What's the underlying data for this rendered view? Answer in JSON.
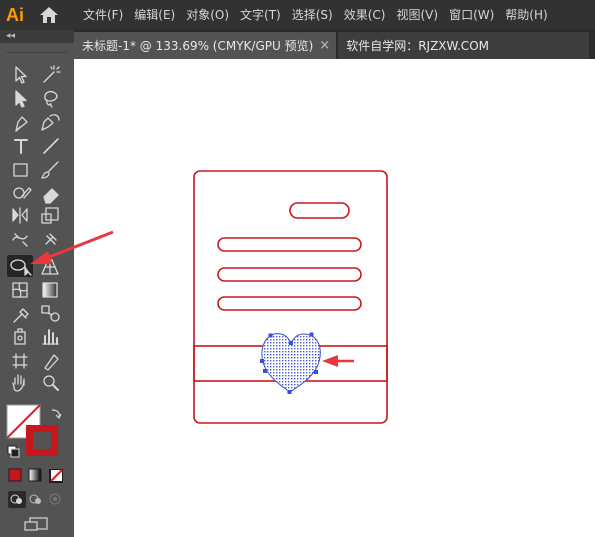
{
  "app": {
    "logo": "Ai"
  },
  "menu": {
    "items": [
      "文件(F)",
      "编辑(E)",
      "对象(O)",
      "文字(T)",
      "选择(S)",
      "效果(C)",
      "视图(V)",
      "窗口(W)",
      "帮助(H)"
    ]
  },
  "tabs": [
    {
      "label": "未标题-1* @ 133.69% (CMYK/GPU 预览)",
      "close": "×"
    },
    {
      "label": "软件自学网：RJZXW.COM"
    }
  ],
  "toolbar": {
    "collapse": "◂◂",
    "tools": [
      "selection-tool",
      "magic-wand-tool",
      "direct-selection-tool",
      "lasso-tool",
      "pen-tool",
      "curvature-tool",
      "type-tool",
      "line-segment-tool",
      "rectangle-tool",
      "paintbrush-tool",
      "shaper-tool",
      "eraser-tool",
      "rotate-tool",
      "scale-tool",
      "width-tool",
      "puppet-warp-tool",
      "shape-builder-tool",
      "perspective-grid-tool",
      "mesh-tool",
      "gradient-tool",
      "eyedropper-tool",
      "blend-tool",
      "symbol-sprayer-tool",
      "column-graph-tool",
      "artboard-tool",
      "slice-tool",
      "hand-tool",
      "zoom-tool"
    ],
    "selected_tool": "shape-builder-tool",
    "fill_color": "#ffffff",
    "stroke_color": "#c8161d"
  },
  "artwork": {
    "stroke_color": "#c8161d",
    "selection_color": "#3b4fd6",
    "arrow_color": "#e8373f"
  }
}
